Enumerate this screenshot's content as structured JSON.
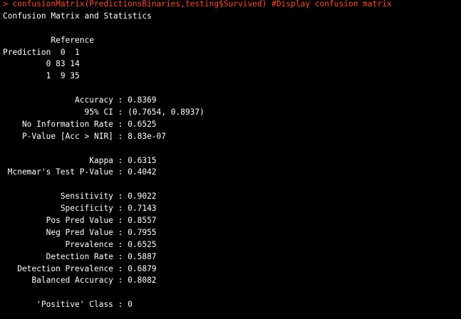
{
  "colors": {
    "background": "#000000",
    "output_text": "#ffffff",
    "command_text": "#ff4a2a"
  },
  "terminal": {
    "command": "> confusionMatrix(PredictionsBinaries,testing$Survived) #Display confusion matrix",
    "header": "Confusion Matrix and Statistics",
    "lines": [
      "",
      "          Reference",
      "Prediction  0  1",
      "         0 83 14",
      "         1  9 35",
      "",
      "               Accuracy : 0.8369",
      "                 95% CI : (0.7654, 0.8937)",
      "    No Information Rate : 0.6525",
      "    P-Value [Acc > NIR] : 8.83e-07",
      "",
      "                  Kappa : 0.6315",
      " Mcnemar's Test P-Value : 0.4042",
      "",
      "            Sensitivity : 0.9022",
      "            Specificity : 0.7143",
      "         Pos Pred Value : 0.8557",
      "         Neg Pred Value : 0.7955",
      "             Prevalence : 0.6525",
      "         Detection Rate : 0.5887",
      "   Detection Prevalence : 0.6879",
      "      Balanced Accuracy : 0.8082",
      "",
      "       'Positive' Class : 0"
    ]
  }
}
